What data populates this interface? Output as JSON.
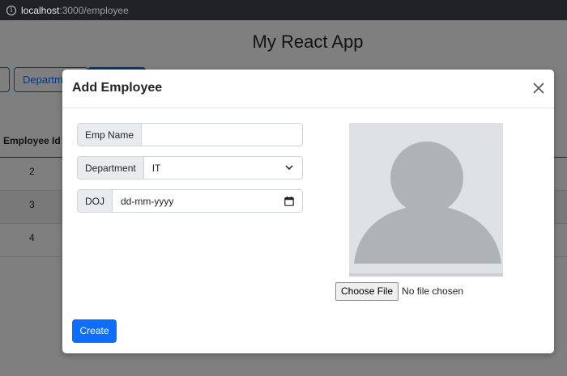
{
  "browser": {
    "url_host": "localhost",
    "url_path": ":3000/employee"
  },
  "app": {
    "title": "My React App",
    "nav_buttons": [
      "",
      "Departm",
      ""
    ],
    "table": {
      "header": "Employee Id",
      "rows": [
        "2",
        "3",
        "4"
      ]
    }
  },
  "modal": {
    "title": "Add Employee",
    "form": {
      "emp_name": {
        "label": "Emp Name",
        "value": ""
      },
      "department": {
        "label": "Department",
        "value": "IT"
      },
      "doj": {
        "label": "DOJ",
        "value": "dd-mm-yyyy"
      }
    },
    "file": {
      "button": "Choose File",
      "status": "No file chosen"
    },
    "create_label": "Create"
  }
}
